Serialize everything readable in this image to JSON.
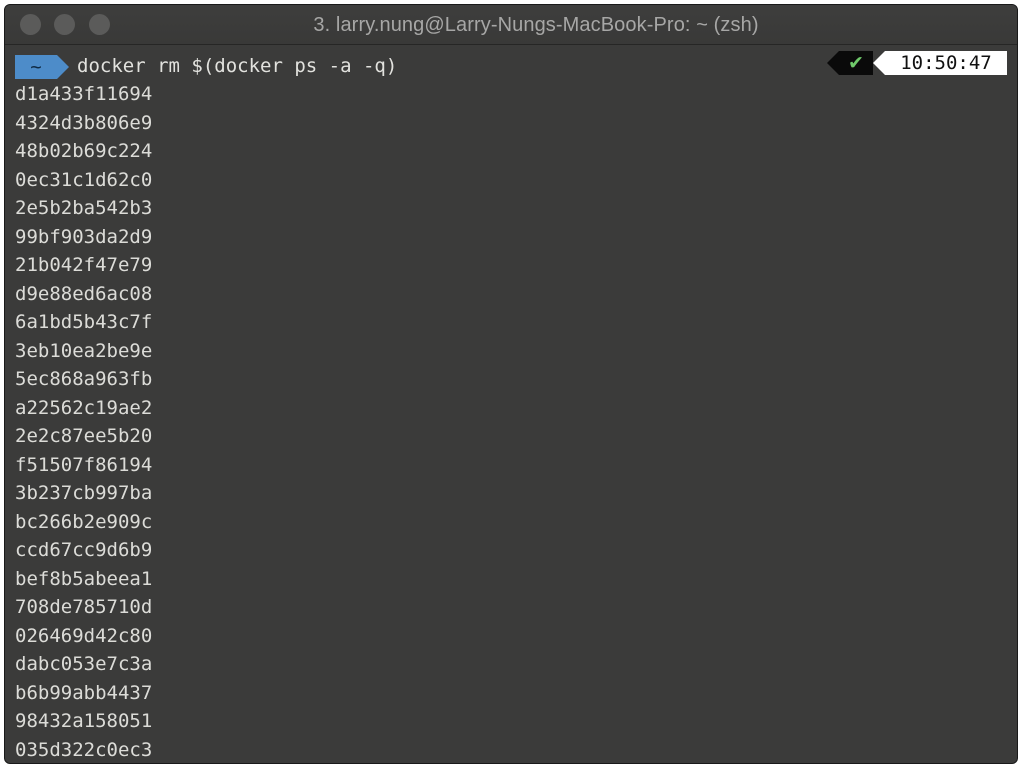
{
  "window": {
    "title": "3. larry.nung@Larry-Nungs-MacBook-Pro: ~ (zsh)"
  },
  "prompt": {
    "directory": "~",
    "command": "docker rm $(docker ps -a -q)",
    "status_icon": "check-icon",
    "status_glyph": "✔",
    "time": "10:50:47"
  },
  "output": [
    "d1a433f11694",
    "4324d3b806e9",
    "48b02b69c224",
    "0ec31c1d62c0",
    "2e5b2ba542b3",
    "99bf903da2d9",
    "21b042f47e79",
    "d9e88ed6ac08",
    "6a1bd5b43c7f",
    "3eb10ea2be9e",
    "5ec868a963fb",
    "a22562c19ae2",
    "2e2c87ee5b20",
    "f51507f86194",
    "3b237cb997ba",
    "bc266b2e909c",
    "ccd67cc9d6b9",
    "bef8b5abeea1",
    "708de785710d",
    "026469d42c80",
    "dabc053e7c3a",
    "b6b99abb4437",
    "98432a158051",
    "035d322c0ec3"
  ],
  "colors": {
    "terminal_bg": "#3b3b3a",
    "dir_segment": "#4d8cc9",
    "status_ok": "#6fc96a"
  }
}
